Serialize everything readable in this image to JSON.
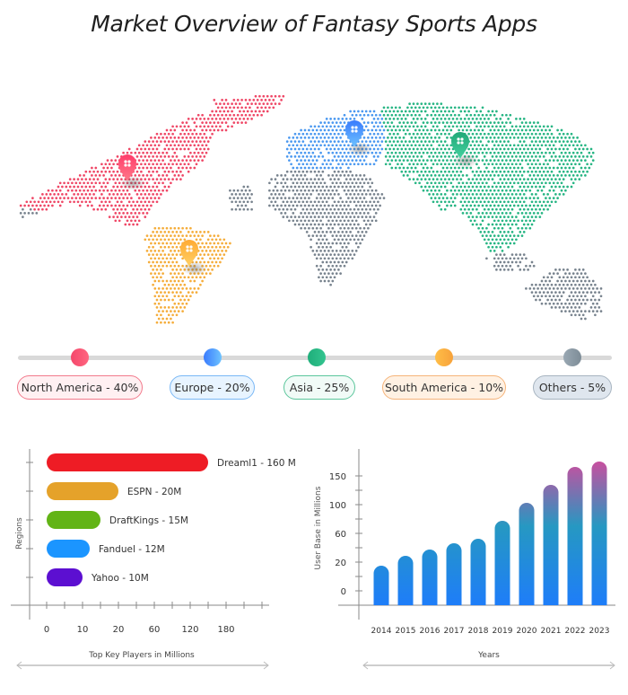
{
  "title": "Market Overview of Fantasy Sports Apps",
  "regions": [
    {
      "label": "North America - 40%",
      "name": "North America",
      "share_pct": 40,
      "color": "#f4476b",
      "color2": "#ff6680",
      "pill_bg": "#fff0f2",
      "pill_border": "#f27a8c"
    },
    {
      "label": "Europe - 20%",
      "name": "Europe",
      "share_pct": 20,
      "color": "#3a7bfd",
      "color2": "#6ec3ff",
      "pill_bg": "#e8f4ff",
      "pill_border": "#7ab8f5"
    },
    {
      "label": "Asia - 25%",
      "name": "Asia",
      "share_pct": 25,
      "color": "#1fae7a",
      "color2": "#33c48f",
      "pill_bg": "#f1fbf7",
      "pill_border": "#5cc69c"
    },
    {
      "label": "South America - 10%",
      "name": "South America",
      "share_pct": 10,
      "color": "#ffbe47",
      "color2": "#f7a23b",
      "pill_bg": "#fff1e3",
      "pill_border": "#f5b47a"
    },
    {
      "label": "Others - 5%",
      "name": "Others",
      "share_pct": 5,
      "color": "#9aa8b3",
      "color2": "#7d8c97",
      "pill_bg": "#dfe6ee",
      "pill_border": "#a7b4c0"
    }
  ],
  "map_colors": {
    "north_america": "#ef4766",
    "europe": "#4a98f0",
    "asia": "#26b583",
    "south_america": "#f5ad3b",
    "others": "#78838e"
  },
  "chart_data": [
    {
      "type": "bar",
      "orientation": "horizontal",
      "title": "",
      "xlabel": "Top Key Players in Millions",
      "ylabel": "Regions",
      "categories": [
        "Dreaml1",
        "ESPN",
        "DraftKings",
        "Fanduel",
        "Yahoo"
      ],
      "values": [
        160,
        20,
        15,
        12,
        10
      ],
      "bar_labels": [
        "Dreaml1 - 160 M",
        "ESPN - 20M",
        "DraftKings - 15M",
        "Fanduel - 12M",
        "Yahoo - 10M"
      ],
      "colors": [
        "#ee1c25",
        "#e5a22a",
        "#62b416",
        "#1b95ff",
        "#5c0fd1"
      ],
      "x_tick_labels": [
        "0",
        "10",
        "20",
        "60",
        "120",
        "180"
      ],
      "grid": false,
      "legend": "none"
    },
    {
      "type": "bar",
      "orientation": "vertical",
      "title": "",
      "xlabel": "Years",
      "ylabel": "User Base in Millions",
      "categories": [
        "2014",
        "2015",
        "2016",
        "2017",
        "2018",
        "2019",
        "2020",
        "2021",
        "2022",
        "2023"
      ],
      "values": [
        18,
        29,
        36,
        43,
        48,
        68,
        88,
        108,
        128,
        148
      ],
      "y_tick_labels": [
        "0",
        "20",
        "60",
        "100",
        "150"
      ],
      "ylim": [
        -10,
        170
      ],
      "gradient": {
        "bottom": "#1e7df9",
        "middle": "#2698c2",
        "top": "#c74f9f"
      },
      "grid": false,
      "legend": "none"
    }
  ]
}
